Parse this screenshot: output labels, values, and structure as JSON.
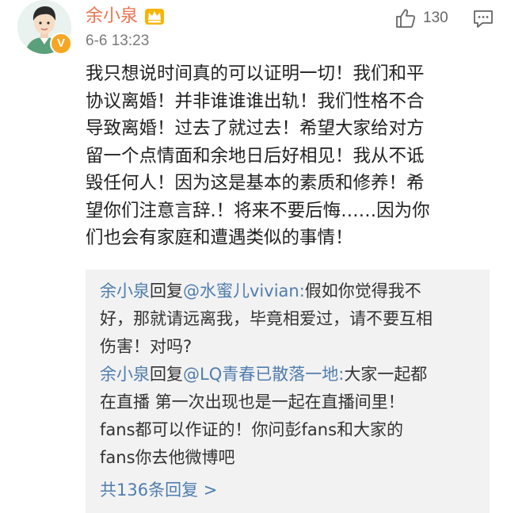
{
  "post": {
    "author": {
      "name": "余小泉",
      "vip_badge": "V",
      "avatar_icon": "avatar-cartoon-portrait",
      "member_icon": "crown-member-icon"
    },
    "timestamp": "6-6 13:23",
    "like": {
      "icon": "thumbs-up-icon",
      "count": "130"
    },
    "reply_icon": "comment-bubble-icon",
    "content_lines": [
      "我只想说时间真的可以证明一切！我们和平",
      "协议离婚！并非谁谁谁出轨！我们性格不合",
      "导致离婚！过去了就过去！希望大家给对方",
      "留一个点情面和余地日后好相见！我从不诋",
      "毁任何人！因为这是基本的素质和修养！希",
      "望你们注意言辞.！将来不要后悔……因为你",
      "们也会有家庭和遭遇类似的事情！"
    ]
  },
  "replies": [
    {
      "author": "余小泉",
      "reply_word": "回复",
      "target": "@水蜜儿vivian",
      "colon": ":",
      "first_line_text": "假如你觉得我不",
      "more_lines": [
        "好，那就请远离我，毕竟相爱过，请不要互相",
        "伤害！对吗?"
      ]
    },
    {
      "author": "余小泉",
      "reply_word": "回复",
      "target": "@LQ青春已散落一地",
      "colon": ":",
      "first_line_text": "大家一起都",
      "more_lines": [
        "在直播 第一次出现也是一起在直播间里！",
        "fans都可以作证的！你问彭fans和大家的",
        "fans你去他微博吧"
      ]
    }
  ],
  "more_replies_label": "共136条回复 >",
  "colors": {
    "username": "#eb7350",
    "link": "#507daf",
    "reply_background": "#f2f2f2",
    "vip_badge": "#f5a623"
  }
}
